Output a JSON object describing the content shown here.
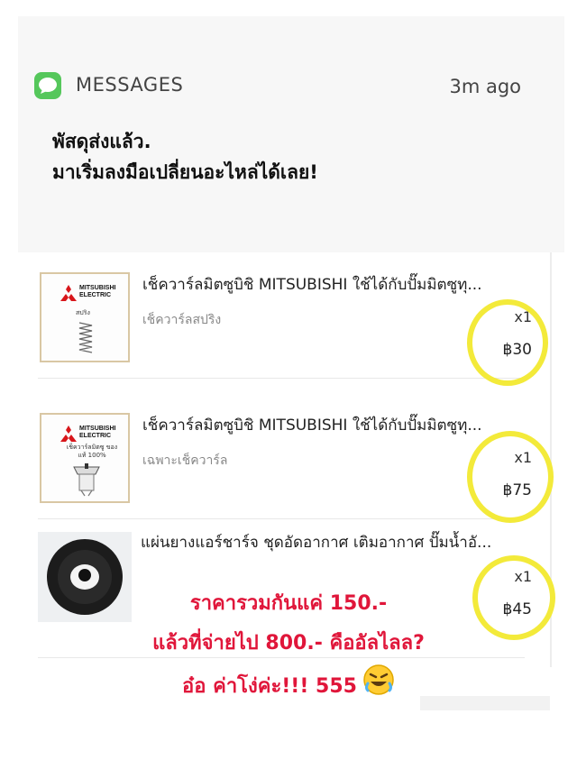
{
  "notification": {
    "app_name": "MESSAGES",
    "time": "3m ago",
    "message_line1": "พัสดุส่งแล้ว.",
    "message_line2": "มาเริ่มลงมือเปลี่ยนอะไหล่ได้เลย!"
  },
  "order": {
    "items": [
      {
        "title": "เช็ควาร์ลมิตซูบิชิ MITSUBISHI ใช้ได้กับปั๊มมิตซูทุ...",
        "variant": "เช็ควาร์ลสปริง",
        "quantity": "x1",
        "price": "฿30",
        "thumb_brand": "MITSUBISHI ELECTRIC",
        "thumb_text": "สปริง"
      },
      {
        "title": "เช็ควาร์ลมิตซูบิชิ MITSUBISHI ใช้ได้กับปั๊มมิตซูทุ...",
        "variant": "เฉพาะเช็ควาร์ล",
        "quantity": "x1",
        "price": "฿75",
        "thumb_brand": "MITSUBISHI ELECTRIC",
        "thumb_text": "เช็ควาร์ลมิตซู ของแท้ 100%"
      },
      {
        "title": "แผ่นยางแอร์ชาร์จ ชุดอัดอากาศ เติมอากาศ ปั๊มน้ำอั...",
        "quantity": "x1",
        "price": "฿45"
      }
    ]
  },
  "caption": {
    "line1": "ราคารวมกันแค่ 150.-",
    "line2": "แล้วที่จ่ายไป 800.- คืออัลไลล?",
    "line3": "อ๋อ ค่าโง่ค่ะ!!! 555"
  },
  "colors": {
    "highlight_circle": "#f3ea3a",
    "caption_text": "#e0163a",
    "messages_icon": "#55c75b"
  },
  "icons": {
    "app_icon": "messages-icon",
    "emoji": "rofl-emoji-icon"
  }
}
